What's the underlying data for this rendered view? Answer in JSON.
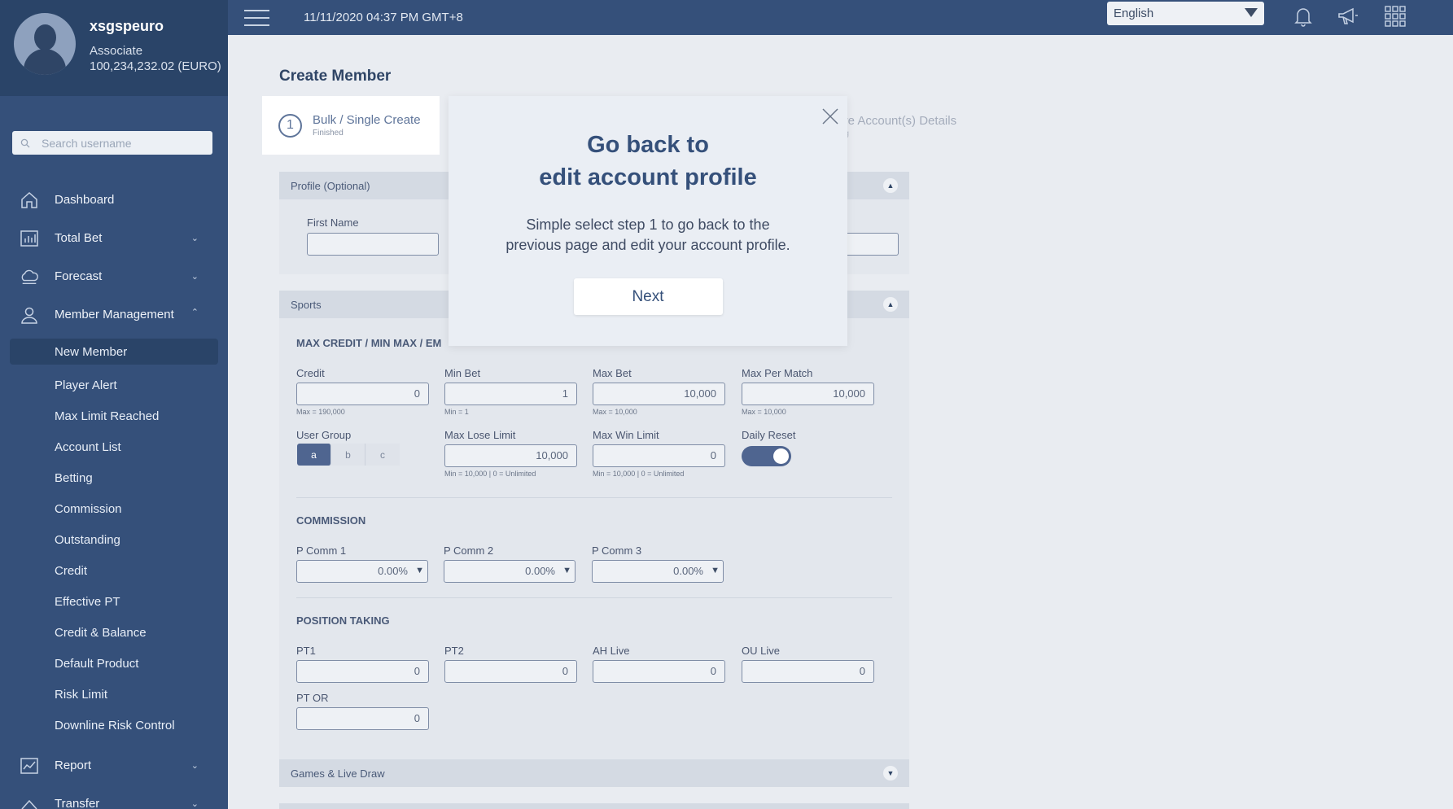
{
  "user": {
    "name": "xsgspeuro",
    "role": "Associate",
    "balance": "100,234,232.02 (EURO)"
  },
  "search": {
    "placeholder": "Search username"
  },
  "nav": {
    "dashboard": "Dashboard",
    "total_bet": "Total Bet",
    "forecast": "Forecast",
    "member_management": "Member Management",
    "sub_items": [
      "New Member",
      "Player Alert",
      "Max Limit Reached",
      "Account List",
      "Betting",
      "Commission",
      "Outstanding",
      "Credit",
      "Effective PT",
      "Credit & Balance",
      "Default Product",
      "Risk Limit",
      "Downline Risk Control"
    ],
    "report": "Report",
    "transfer": "Transfer"
  },
  "topbar": {
    "datetime": "11/11/2020 04:37 PM GMT+8",
    "language": "English"
  },
  "page": {
    "title": "Create Member",
    "step1_num": "1",
    "step1_title": "Bulk / Single Create",
    "step1_status": "Finished",
    "step4_title": "Share Account(s) Details",
    "step4_status": "Waiting"
  },
  "profile": {
    "header": "Profile (Optional)",
    "first_name_label": "First Name",
    "first_name_value": ""
  },
  "sports": {
    "header": "Sports",
    "section_limits": "MAX CREDIT / MIN MAX / EM",
    "credit_label": "Credit",
    "credit_value": "0",
    "credit_hint": "Max = 190,000",
    "min_bet_label": "Min Bet",
    "min_bet_value": "1",
    "min_bet_hint": "Min = 1",
    "max_bet_label": "Max Bet",
    "max_bet_value": "10,000",
    "max_bet_hint": "Max = 10,000",
    "max_per_match_label": "Max Per Match",
    "max_per_match_value": "10,000",
    "max_per_match_hint": "Max = 10,000",
    "user_group_label": "User Group",
    "user_groups": [
      "a",
      "b",
      "c"
    ],
    "max_lose_label": "Max Lose Limit",
    "max_lose_value": "10,000",
    "max_lose_hint": "Min = 10,000 | 0 = Unlimited",
    "max_win_label": "Max Win Limit",
    "max_win_value": "0",
    "max_win_hint": "Min = 10,000 | 0 = Unlimited",
    "daily_reset_label": "Daily Reset",
    "section_commission": "COMMISSION",
    "pcomm1_label": "P Comm 1",
    "pcomm1_value": "0.00%",
    "pcomm2_label": "P Comm 2",
    "pcomm2_value": "0.00%",
    "pcomm3_label": "P Comm 3",
    "pcomm3_value": "0.00%",
    "section_pt": "POSITION TAKING",
    "pt1_label": "PT1",
    "pt1_value": "0",
    "pt2_label": "PT2",
    "pt2_value": "0",
    "ah_live_label": "AH Live",
    "ah_live_value": "0",
    "ou_live_label": "OU Live",
    "ou_live_value": "0",
    "pt_or_label": "PT OR",
    "pt_or_value": "0"
  },
  "games": {
    "header": "Games & Live Draw"
  },
  "modal": {
    "title_line1": "Go back to",
    "title_line2": "edit account profile",
    "text_line1": "Simple select step 1 to go back to the",
    "text_line2": "previous page and edit your account profile.",
    "button": "Next"
  }
}
